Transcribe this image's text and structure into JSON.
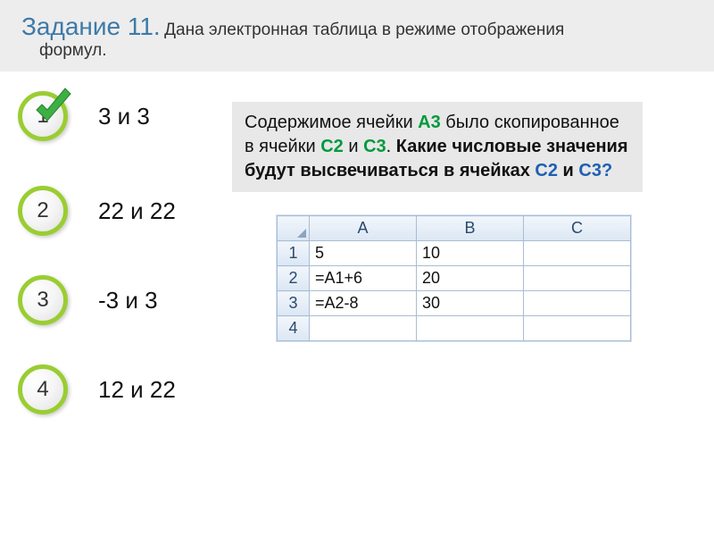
{
  "header": {
    "title": "Задание 11.",
    "subtitle": "Дана электронная таблица в режиме отображения",
    "line2": "формул."
  },
  "options": [
    {
      "num": "1",
      "text": "3 и 3",
      "correct": true
    },
    {
      "num": "2",
      "text": "22 и 22",
      "correct": false
    },
    {
      "num": "3",
      "text": "-3 и 3",
      "correct": false
    },
    {
      "num": "4",
      "text": "12 и 22",
      "correct": false
    }
  ],
  "question": {
    "p1_a": "Содержимое ячейки ",
    "p1_b": "А3",
    "p1_c": " было скопированное в ячейки ",
    "p1_d": "С2",
    "p1_e": " и ",
    "p1_f": "С3",
    "p1_g": ".",
    "p2_a": "Какие числовые значения будут высвечиваться в ячейках ",
    "p2_b": "С2",
    "p2_c": " и ",
    "p2_d": "С3",
    "p2_e": "?"
  },
  "sheet": {
    "columns": [
      "A",
      "B",
      "C"
    ],
    "rows": [
      {
        "r": "1",
        "a": "5",
        "b": "10",
        "c": ""
      },
      {
        "r": "2",
        "a": "=A1+6",
        "b": "20",
        "c": ""
      },
      {
        "r": "3",
        "a": "=A2-8",
        "b": "30",
        "c": ""
      },
      {
        "r": "4",
        "a": "",
        "b": "",
        "c": ""
      }
    ]
  }
}
